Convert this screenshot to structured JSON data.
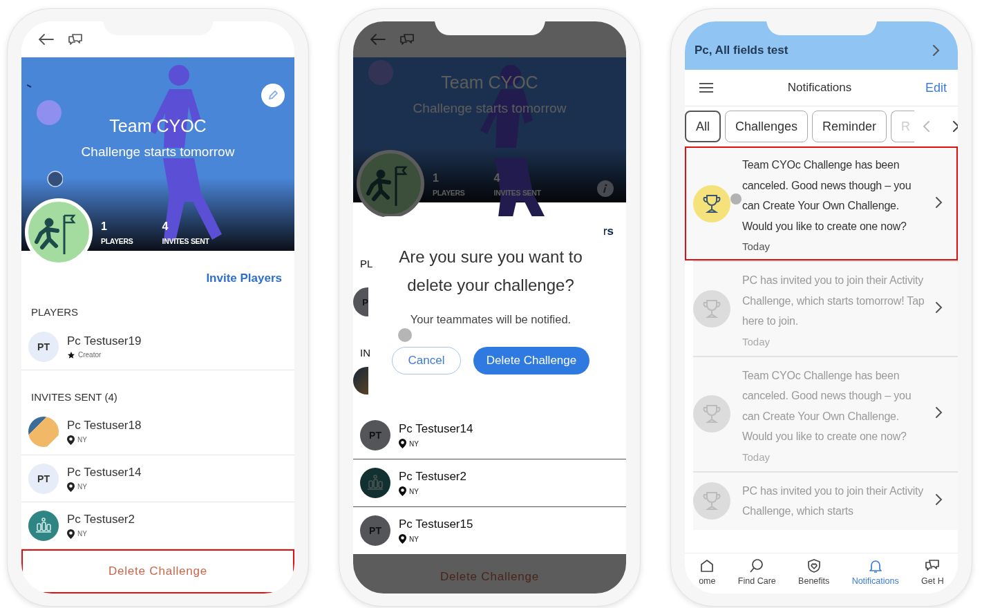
{
  "challenge_screen": {
    "hero": {
      "title": "Team CYOC",
      "subtitle": "Challenge starts tomorrow",
      "stats": [
        {
          "value": "1",
          "label": "PLAYERS"
        },
        {
          "value": "4",
          "label": "INVITES SENT"
        }
      ]
    },
    "invite_link": "Invite Players",
    "sections": [
      {
        "heading": "PLAYERS",
        "rows": [
          {
            "name": "Pc Testuser19",
            "avatar": {
              "kind": "initials",
              "initials": "PT"
            },
            "detail": {
              "kind": "creator",
              "text": "Creator"
            }
          }
        ]
      },
      {
        "heading": "INVITES SENT (4)",
        "rows": [
          {
            "name": "Pc Testuser18",
            "avatar": {
              "kind": "image"
            },
            "detail": {
              "kind": "location",
              "text": "NY"
            }
          },
          {
            "name": "Pc Testuser14",
            "avatar": {
              "kind": "initials",
              "initials": "PT"
            },
            "detail": {
              "kind": "location",
              "text": "NY"
            }
          },
          {
            "name": "Pc Testuser2",
            "avatar": {
              "kind": "icon"
            },
            "detail": {
              "kind": "location",
              "text": "NY"
            }
          }
        ]
      }
    ],
    "delete_button": {
      "label": "Delete Challenge",
      "highlighted": true
    }
  },
  "dialog_screen": {
    "hero": {
      "title": "Team CYOC",
      "subtitle": "Challenge starts tomorrow",
      "stats": [
        {
          "value": "1",
          "label": "PLAYERS"
        },
        {
          "value": "4",
          "label": "INVITES SENT"
        }
      ]
    },
    "peek": {
      "link": "rs",
      "heading_1": "PL",
      "initials": "P",
      "heading_2": "IN"
    },
    "rows": [
      {
        "name": "Pc Testuser14",
        "avatar": {
          "kind": "initials",
          "initials": "PT"
        },
        "detail": {
          "kind": "location",
          "text": "NY"
        }
      },
      {
        "name": "Pc Testuser2",
        "avatar": {
          "kind": "icon"
        },
        "detail": {
          "kind": "location",
          "text": "NY"
        }
      },
      {
        "name": "Pc Testuser15",
        "avatar": {
          "kind": "initials",
          "initials": "PT"
        },
        "detail": {
          "kind": "location",
          "text": "NY"
        }
      }
    ],
    "delete_button": {
      "label": "Delete Challenge",
      "highlighted": false
    },
    "dialog": {
      "title": "Are you sure you want to delete your challenge?",
      "message": "Your teammates will be notified.",
      "buttons": [
        {
          "label": "Cancel",
          "kind": "secondary"
        },
        {
          "label": "Delete Challenge",
          "kind": "primary"
        }
      ]
    }
  },
  "notifications_screen": {
    "banner": "Pc, All fields test",
    "title": "Notifications",
    "edit": "Edit",
    "filters": [
      {
        "label": "All",
        "selected": true
      },
      {
        "label": "Challenges",
        "selected": false
      },
      {
        "label": "Reminder",
        "selected": false
      },
      {
        "label": "R",
        "selected": false
      }
    ],
    "items": [
      {
        "text": "Team CYOc Challenge has been canceled. Good news though – you can Create Your Own Challenge. Would you like to create one now?",
        "date": "Today",
        "read": false,
        "highlighted": true
      },
      {
        "text": "PC has invited you to join their Activity Challenge, which starts tomorrow! Tap here to join.",
        "date": "Today",
        "read": true,
        "highlighted": false
      },
      {
        "text": "Team CYOc Challenge has been canceled. Good news though – you can Create Your Own Challenge. Would you like to create one now?",
        "date": "Today",
        "read": true,
        "highlighted": false
      },
      {
        "text": "PC has invited you to join their Activity Challenge, which starts",
        "read": true,
        "highlighted": false
      }
    ],
    "tabs": [
      {
        "label": "ome",
        "selected": false
      },
      {
        "label": "Find Care",
        "selected": false
      },
      {
        "label": "Benefits",
        "selected": false
      },
      {
        "label": "Notifications",
        "selected": true
      },
      {
        "label": "Get H",
        "selected": false
      }
    ]
  }
}
